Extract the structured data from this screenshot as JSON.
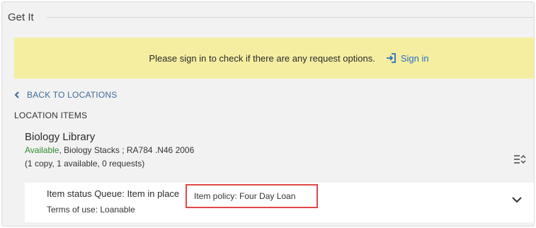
{
  "section": {
    "title": "Get It"
  },
  "signin_banner": {
    "message": "Please sign in to check if there are any request options.",
    "link_label": "Sign in"
  },
  "back_link": {
    "label": "BACK TO LOCATIONS"
  },
  "location_items": {
    "heading": "LOCATION ITEMS"
  },
  "library": {
    "name": "Biology Library",
    "availability": "Available",
    "location_detail": ", Biology Stacks ; RA784 .N46 2006",
    "counts": "(1 copy, 1 available, 0 requests)"
  },
  "item": {
    "status": "Item status Queue: Item in place",
    "policy": "Item policy: Four Day Loan",
    "terms": "Terms of use: Loanable"
  },
  "colors": {
    "banner_bg": "#f5eea0",
    "available": "#2e8b2e",
    "link": "#2a6fc1",
    "highlight_border": "#e04848"
  },
  "icons": {
    "signin": "sign-in-icon",
    "back": "chevron-left-icon",
    "sort": "sort-icon",
    "expand": "chevron-down-icon"
  }
}
